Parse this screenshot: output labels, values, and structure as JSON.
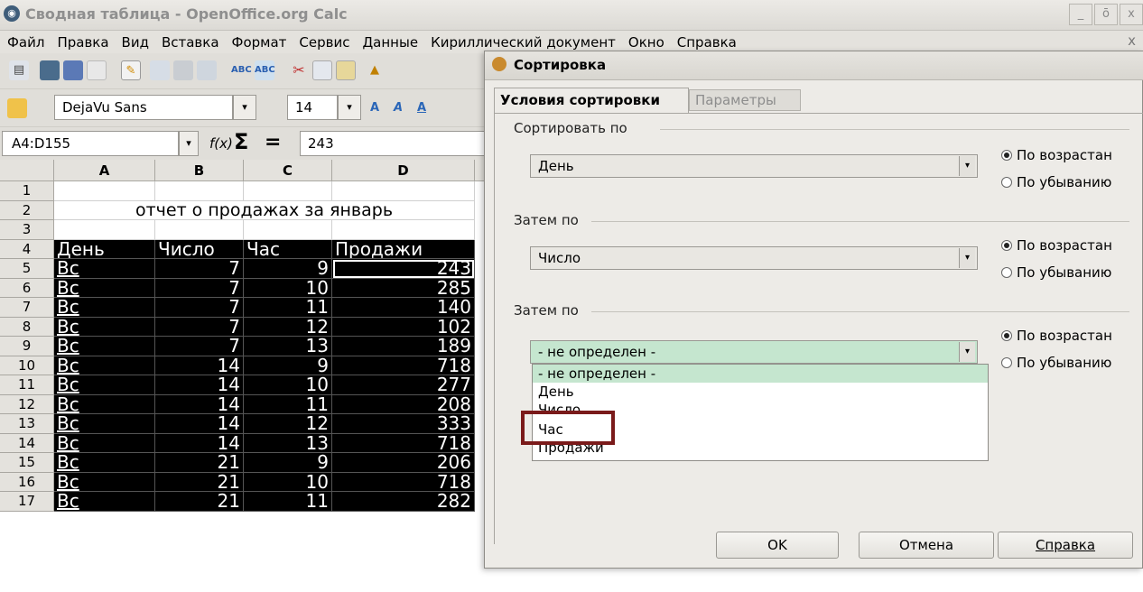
{
  "window": {
    "title": "Сводная таблица - OpenOffice.org Calc",
    "controls": [
      "_",
      "ō",
      "x"
    ]
  },
  "menu": {
    "items": [
      "Файл",
      "Правка",
      "Вид",
      "Вставка",
      "Формат",
      "Сервис",
      "Данные",
      "Кириллический документ",
      "Окно",
      "Справка"
    ],
    "close": "x"
  },
  "toolbar": {
    "font_name": "DejaVu Sans",
    "font_size": "14",
    "dropdown_arrow": "▾"
  },
  "formula_bar": {
    "cell_ref": "A4:D155",
    "fx": "f(x)",
    "sum": "Σ",
    "equals": "=",
    "value": "243"
  },
  "sheet": {
    "columns": [
      "A",
      "B",
      "C",
      "D"
    ],
    "row_numbers": [
      "1",
      "2",
      "3",
      "4",
      "5",
      "6",
      "7",
      "8",
      "9",
      "10",
      "11",
      "12",
      "13",
      "14",
      "15",
      "16",
      "17"
    ],
    "title": "отчет о продажах за январь",
    "headers": [
      "День",
      "Число",
      "Час",
      "Продажи"
    ],
    "rows": [
      [
        "Вс",
        "7",
        "9",
        "243"
      ],
      [
        "Вс",
        "7",
        "10",
        "285"
      ],
      [
        "Вс",
        "7",
        "11",
        "140"
      ],
      [
        "Вс",
        "7",
        "12",
        "102"
      ],
      [
        "Вс",
        "7",
        "13",
        "189"
      ],
      [
        "Вс",
        "14",
        "9",
        "718"
      ],
      [
        "Вс",
        "14",
        "10",
        "277"
      ],
      [
        "Вс",
        "14",
        "11",
        "208"
      ],
      [
        "Вс",
        "14",
        "12",
        "333"
      ],
      [
        "Вс",
        "14",
        "13",
        "718"
      ],
      [
        "Вс",
        "21",
        "9",
        "206"
      ],
      [
        "Вс",
        "21",
        "10",
        "718"
      ],
      [
        "Вс",
        "21",
        "11",
        "282"
      ]
    ]
  },
  "dialog": {
    "title": "Сортировка",
    "tabs": [
      "Условия сортировки",
      "Параметры"
    ],
    "sort_by_label": "Сортировать по",
    "then_by_label": "Затем по",
    "key1": "День",
    "key2": "Число",
    "key3": "- не определен -",
    "asc": "По возрастан",
    "desc": "По убыванию",
    "dropdown_options": [
      "- не определен -",
      "День",
      "Число",
      "Час",
      "Продажи"
    ],
    "buttons": {
      "ok": "OK",
      "cancel": "Отмена",
      "help": "Справка"
    }
  }
}
